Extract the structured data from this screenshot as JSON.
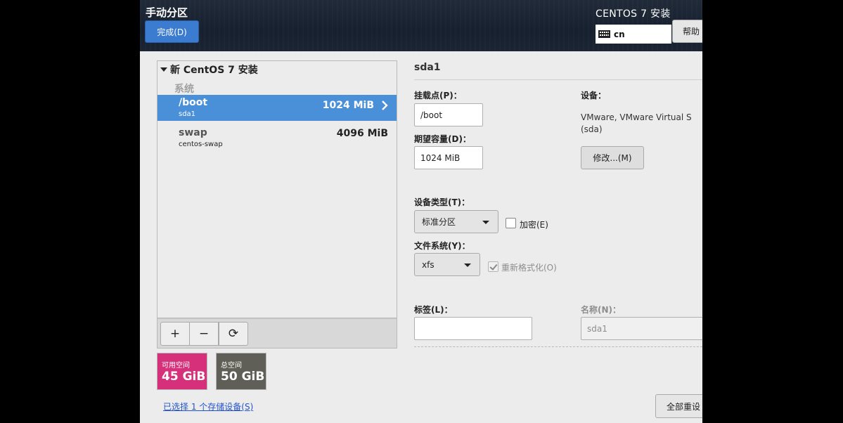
{
  "header": {
    "title": "手动分区",
    "done_label": "完成(D)",
    "installer_title": "CENTOS 7 安装",
    "keyboard_layout": "cn",
    "help_label": "帮助"
  },
  "mount_list": {
    "heading": "新 CentOS 7 安装",
    "group": "系统",
    "rows": [
      {
        "mount_point": "/boot",
        "device": "sda1",
        "size": "1024 MiB",
        "selected": true
      },
      {
        "mount_point": "swap",
        "device": "centos-swap",
        "size": "4096 MiB",
        "selected": false
      }
    ],
    "toolbar": {
      "add": "+",
      "remove": "−",
      "refresh": "⟳"
    }
  },
  "storage": {
    "available_label": "可用空间",
    "available_value": "45 GiB",
    "total_label": "总空间",
    "total_value": "50 GiB",
    "devices_link": "已选择 1 个存储设备(S)"
  },
  "details": {
    "partition_name": "sda1",
    "mount_point_label": "挂载点(P)：",
    "mount_point_value": "/boot",
    "capacity_label": "期望容量(D)：",
    "capacity_value": "1024 MiB",
    "device_label": "设备：",
    "device_line1": "VMware, VMware Virtual S",
    "device_line2": "(sda)",
    "modify_label": "修改...(M)",
    "device_type_label": "设备类型(T)：",
    "device_type_value": "标准分区",
    "encrypt_label": "加密(E)",
    "encrypt_checked": false,
    "filesystem_label": "文件系统(Y)：",
    "filesystem_value": "xfs",
    "reformat_label": "重新格式化(O)",
    "reformat_checked": true,
    "tag_label": "标签(L)：",
    "tag_value": "",
    "name_label": "名称(N)：",
    "name_value": "sda1",
    "reset_all_label": "全部重设"
  },
  "colors": {
    "accent": "#4a90d9",
    "done_button": "#3b7bd0",
    "available": "#d6307a",
    "total": "#5f5f57"
  }
}
